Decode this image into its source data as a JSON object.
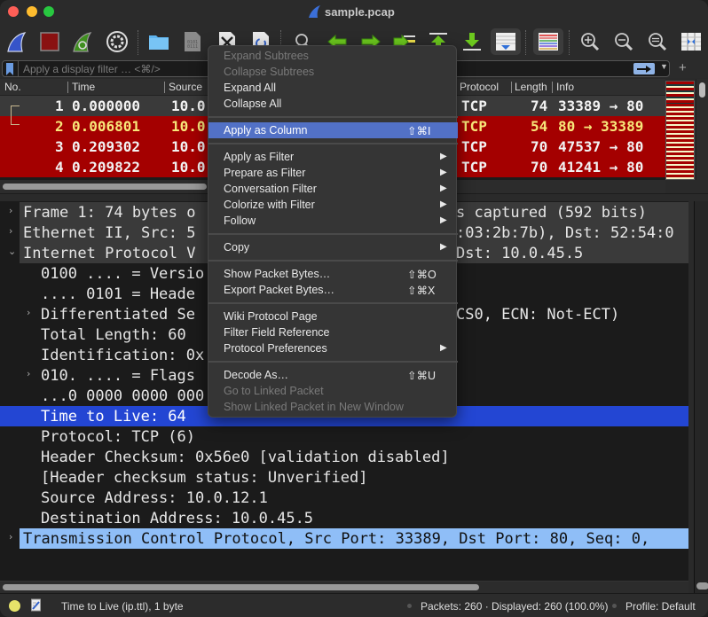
{
  "window": {
    "title": "sample.pcap"
  },
  "toolbar": {
    "buttons": [
      {
        "name": "start-capture",
        "icon": "shark-fin-blue-icon"
      },
      {
        "name": "stop-capture",
        "icon": "stop-square-icon"
      },
      {
        "name": "restart-capture",
        "icon": "shark-fin-restart-icon"
      },
      {
        "name": "capture-options",
        "icon": "gear-icon"
      },
      {
        "name": "open-file",
        "icon": "folder-icon"
      },
      {
        "name": "save-file",
        "icon": "binary-file-icon"
      },
      {
        "name": "close-file",
        "icon": "close-file-icon"
      },
      {
        "name": "reload-file",
        "icon": "reload-file-icon"
      },
      {
        "name": "find-packet",
        "icon": "search-icon"
      },
      {
        "name": "go-back",
        "icon": "arrow-left-icon"
      },
      {
        "name": "go-forward",
        "icon": "arrow-right-icon"
      },
      {
        "name": "go-to-packet",
        "icon": "go-to-packet-icon"
      },
      {
        "name": "go-first",
        "icon": "arrow-up-to-top-icon"
      },
      {
        "name": "go-last",
        "icon": "arrow-down-to-bottom-icon"
      },
      {
        "name": "auto-scroll",
        "icon": "auto-scroll-icon"
      },
      {
        "name": "colorize",
        "icon": "colorize-lines-icon"
      },
      {
        "name": "zoom-in",
        "icon": "zoom-in-icon"
      },
      {
        "name": "zoom-out",
        "icon": "zoom-out-icon"
      },
      {
        "name": "zoom-normal",
        "icon": "zoom-reset-icon"
      },
      {
        "name": "resize-columns",
        "icon": "resize-columns-icon"
      }
    ]
  },
  "filter": {
    "placeholder": "Apply a display filter … <⌘/>",
    "value": "",
    "add_label": "+"
  },
  "packet_list": {
    "columns": [
      "No.",
      "Time",
      "Source",
      "Protocol",
      "Length",
      "Info"
    ],
    "rows": [
      {
        "no": "1",
        "time": "0.000000",
        "source": "10.0",
        "protocol": "TCP",
        "length": "74",
        "info": "33389 → 80",
        "style": "selected"
      },
      {
        "no": "2",
        "time": "0.006801",
        "source": "10.0",
        "protocol": "TCP",
        "length": "54",
        "info": "80 → 33389",
        "style": "red-yellow"
      },
      {
        "no": "3",
        "time": "0.209302",
        "source": "10.0",
        "protocol": "TCP",
        "length": "70",
        "info": "47537 → 80",
        "style": "red"
      },
      {
        "no": "4",
        "time": "0.209822",
        "source": "10.0",
        "protocol": "TCP",
        "length": "70",
        "info": "41241 → 80",
        "style": "red"
      }
    ]
  },
  "details": {
    "rows": [
      {
        "text": "Frame 1: 74 bytes o",
        "text_right": "s captured (592 bits)",
        "arrow": "›",
        "level": 0,
        "style": "header"
      },
      {
        "text": "Ethernet II, Src: 5",
        "text_right": ":03:2b:7b), Dst: 52:54:0",
        "arrow": "›",
        "level": 0,
        "style": "header"
      },
      {
        "text": "Internet Protocol V",
        "text_right": "Dst: 10.0.45.5",
        "arrow": "⌄",
        "level": 0,
        "style": "header"
      },
      {
        "text": "0100 .... = Versio",
        "arrow": "",
        "level": 1
      },
      {
        "text": ".... 0101 = Heade",
        "arrow": "",
        "level": 1
      },
      {
        "text": "Differentiated Se",
        "text_right": "CS0, ECN: Not-ECT)",
        "arrow": "›",
        "level": 1
      },
      {
        "text": "Total Length: 60",
        "arrow": "",
        "level": 1
      },
      {
        "text": "Identification: 0x",
        "arrow": "",
        "level": 1
      },
      {
        "text": "010. .... = Flags",
        "arrow": "›",
        "level": 1
      },
      {
        "text": "...0 0000 0000 000",
        "arrow": "",
        "level": 1
      },
      {
        "text": "Time to Live: 64",
        "arrow": "",
        "level": 1,
        "style": "selected"
      },
      {
        "text": "Protocol: TCP (6)",
        "arrow": "",
        "level": 1
      },
      {
        "text": "Header Checksum: 0x56e0 [validation disabled]",
        "arrow": "",
        "level": 1
      },
      {
        "text": "[Header checksum status: Unverified]",
        "arrow": "",
        "level": 1
      },
      {
        "text": "Source Address: 10.0.12.1",
        "arrow": "",
        "level": 1
      },
      {
        "text": "Destination Address: 10.0.45.5",
        "arrow": "",
        "level": 1
      },
      {
        "text": "Transmission Control Protocol, Src Port: 33389, Dst Port: 80, Seq: 0,",
        "arrow": "›",
        "level": 0,
        "style": "related"
      }
    ]
  },
  "context_menu": {
    "items": [
      {
        "label": "Expand Subtrees",
        "disabled": true
      },
      {
        "label": "Collapse Subtrees",
        "disabled": true
      },
      {
        "label": "Expand All"
      },
      {
        "label": "Collapse All"
      },
      {
        "separator": true
      },
      {
        "label": "Apply as Column",
        "shortcut": "⇧⌘I",
        "active": true
      },
      {
        "separator": true
      },
      {
        "label": "Apply as Filter",
        "submenu": "▶"
      },
      {
        "label": "Prepare as Filter",
        "submenu": "▶"
      },
      {
        "label": "Conversation Filter",
        "submenu": "▶"
      },
      {
        "label": "Colorize with Filter",
        "submenu": "▶"
      },
      {
        "label": "Follow",
        "submenu": "▶"
      },
      {
        "separator": true
      },
      {
        "label": "Copy",
        "submenu": "▶"
      },
      {
        "separator": true
      },
      {
        "label": "Show Packet Bytes…",
        "shortcut": "⇧⌘O"
      },
      {
        "label": "Export Packet Bytes…",
        "shortcut": "⇧⌘X"
      },
      {
        "separator": true
      },
      {
        "label": "Wiki Protocol Page"
      },
      {
        "label": "Filter Field Reference"
      },
      {
        "label": "Protocol Preferences",
        "submenu": "▶"
      },
      {
        "separator": true
      },
      {
        "label": "Decode As…",
        "shortcut": "⇧⌘U"
      },
      {
        "label": "Go to Linked Packet",
        "disabled": true
      },
      {
        "label": "Show Linked Packet in New Window",
        "disabled": true
      }
    ]
  },
  "status": {
    "field_info": "Time to Live (ip.ttl), 1 byte",
    "packets": "Packets: 260 · Displayed: 260 (100.0%)",
    "profile": "Profile: Default"
  },
  "colors": {
    "selected_blue": "#2346d3",
    "related_blue": "#8fbef7",
    "bad_tcp_red": "#a40000",
    "menu_highlight": "#5271c6",
    "status_led": "#e6e36a"
  }
}
